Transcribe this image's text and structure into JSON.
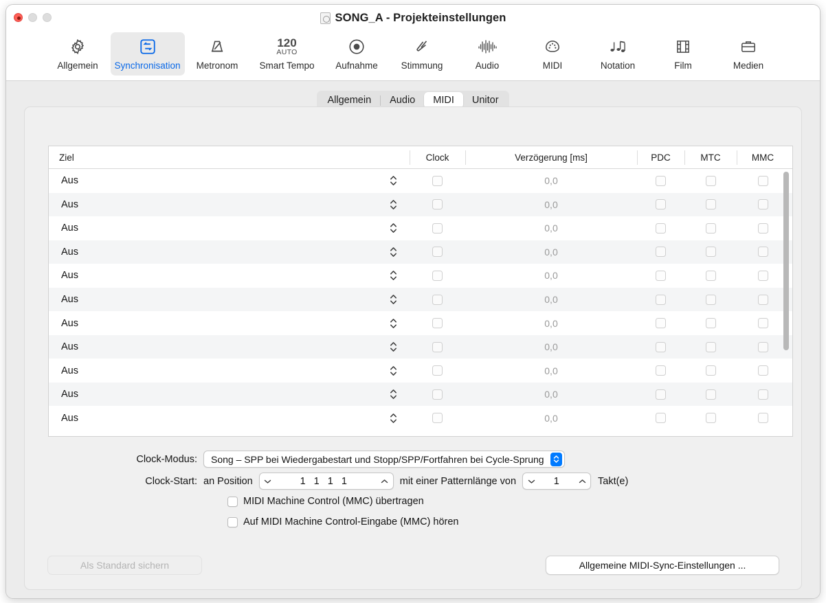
{
  "window": {
    "title": "SONG_A - Projekteinstellungen",
    "doc_icon": "document-icon",
    "traffic": {
      "close": "close-button",
      "minimize": "minimize-button",
      "zoom": "zoom-button"
    }
  },
  "toolbar": {
    "items": [
      {
        "label": "Allgemein",
        "icon": "gear-icon",
        "selected": false
      },
      {
        "label": "Synchronisation",
        "icon": "sync-arrows-icon",
        "selected": true
      },
      {
        "label": "Metronom",
        "icon": "metronome-icon",
        "selected": false
      },
      {
        "label": "Smart Tempo",
        "icon": "tempo-icon",
        "selected": false,
        "tempo_value": "120",
        "tempo_mode": "AUTO"
      },
      {
        "label": "Aufnahme",
        "icon": "record-icon",
        "selected": false
      },
      {
        "label": "Stimmung",
        "icon": "tuning-fork-icon",
        "selected": false
      },
      {
        "label": "Audio",
        "icon": "waveform-icon",
        "selected": false
      },
      {
        "label": "MIDI",
        "icon": "midi-port-icon",
        "selected": false
      },
      {
        "label": "Notation",
        "icon": "notes-icon",
        "selected": false
      },
      {
        "label": "Film",
        "icon": "filmstrip-icon",
        "selected": false
      },
      {
        "label": "Medien",
        "icon": "briefcase-icon",
        "selected": false
      }
    ]
  },
  "tabs": {
    "items": [
      {
        "label": "Allgemein",
        "active": false
      },
      {
        "label": "Audio",
        "active": false
      },
      {
        "label": "MIDI",
        "active": true
      },
      {
        "label": "Unitor",
        "active": false
      }
    ]
  },
  "table": {
    "columns": [
      "Ziel",
      "Clock",
      "Verzögerung [ms]",
      "PDC",
      "MTC",
      "MMC"
    ],
    "rows": [
      {
        "ziel": "Aus",
        "clock": false,
        "delay": "0,0",
        "pdc": false,
        "mtc": false,
        "mmc": false
      },
      {
        "ziel": "Aus",
        "clock": false,
        "delay": "0,0",
        "pdc": false,
        "mtc": false,
        "mmc": false
      },
      {
        "ziel": "Aus",
        "clock": false,
        "delay": "0,0",
        "pdc": false,
        "mtc": false,
        "mmc": false
      },
      {
        "ziel": "Aus",
        "clock": false,
        "delay": "0,0",
        "pdc": false,
        "mtc": false,
        "mmc": false
      },
      {
        "ziel": "Aus",
        "clock": false,
        "delay": "0,0",
        "pdc": false,
        "mtc": false,
        "mmc": false
      },
      {
        "ziel": "Aus",
        "clock": false,
        "delay": "0,0",
        "pdc": false,
        "mtc": false,
        "mmc": false
      },
      {
        "ziel": "Aus",
        "clock": false,
        "delay": "0,0",
        "pdc": false,
        "mtc": false,
        "mmc": false
      },
      {
        "ziel": "Aus",
        "clock": false,
        "delay": "0,0",
        "pdc": false,
        "mtc": false,
        "mmc": false
      },
      {
        "ziel": "Aus",
        "clock": false,
        "delay": "0,0",
        "pdc": false,
        "mtc": false,
        "mmc": false
      },
      {
        "ziel": "Aus",
        "clock": false,
        "delay": "0,0",
        "pdc": false,
        "mtc": false,
        "mmc": false
      },
      {
        "ziel": "Aus",
        "clock": false,
        "delay": "0,0",
        "pdc": false,
        "mtc": false,
        "mmc": false
      }
    ]
  },
  "form": {
    "clock_modus_label": "Clock-Modus:",
    "clock_modus_value": "Song – SPP bei Wiedergabestart und Stopp/SPP/Fortfahren bei Cycle-Sprung",
    "clock_start_label": "Clock-Start:",
    "clock_start_prefix": "an Position",
    "position_value": "1 1 1 1",
    "pattern_prefix": "mit einer Patternlänge von",
    "pattern_value": "1",
    "pattern_suffix": "Takt(e)",
    "mmc_send_label": "MIDI Machine Control (MMC) übertragen",
    "mmc_send_checked": false,
    "mmc_listen_label": "Auf MIDI Machine Control-Eingabe (MMC) hören",
    "mmc_listen_checked": false
  },
  "footer": {
    "save_default_label": "Als Standard sichern",
    "save_default_disabled": true,
    "general_midi_label": "Allgemeine MIDI-Sync-Einstellungen ..."
  },
  "colors": {
    "accent": "#0a69e8",
    "popup_blue": "#007aff",
    "close_red": "#ff5f57"
  }
}
